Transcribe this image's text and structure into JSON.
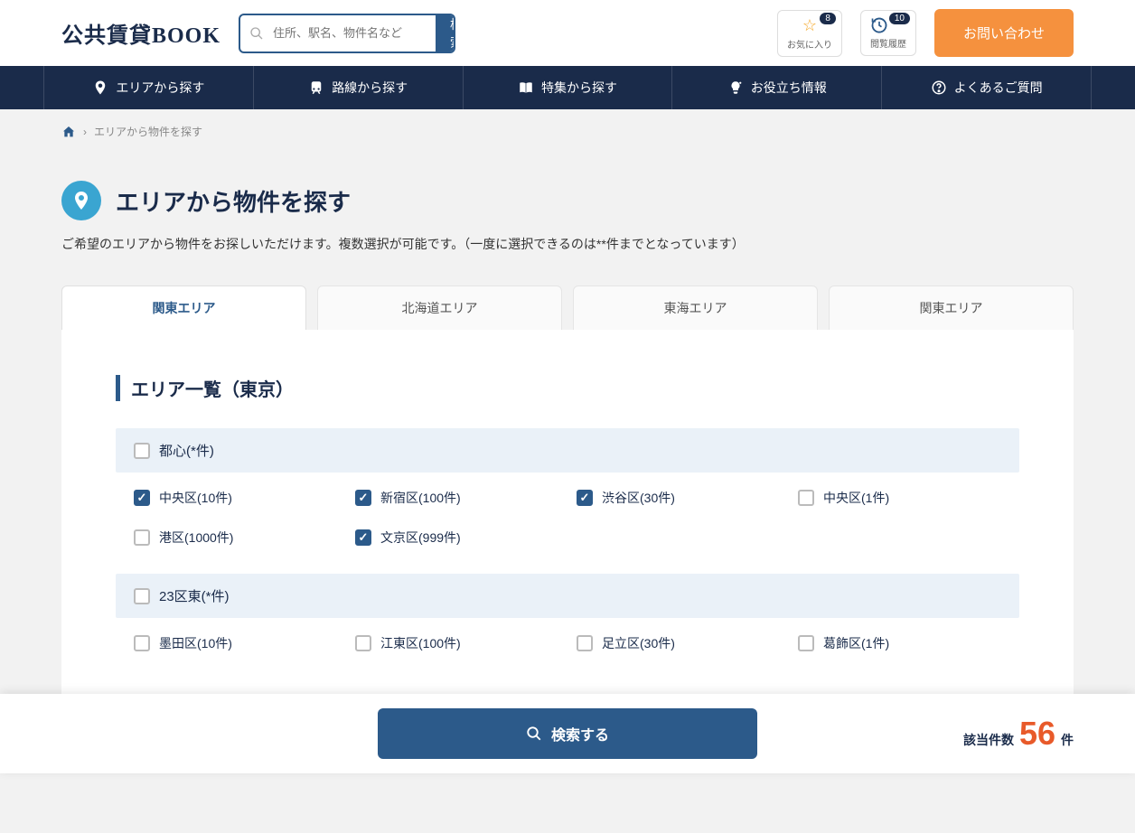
{
  "header": {
    "logo": "公共賃貸BOOK",
    "search_placeholder": "住所、駅名、物件名など",
    "search_button": "検索",
    "favorites_label": "お気に入り",
    "favorites_count": "8",
    "history_label": "閲覧履歴",
    "history_count": "10",
    "contact_label": "お問い合わせ"
  },
  "nav": {
    "area": "エリアから探す",
    "line": "路線から探す",
    "feature": "特集から探す",
    "info": "お役立ち情報",
    "faq": "よくあるご質問"
  },
  "breadcrumb": {
    "current": "エリアから物件を探す"
  },
  "page": {
    "title": "エリアから物件を探す",
    "desc": "ご希望のエリアから物件をお探しいただけます。複数選択が可能です。（一度に選択できるのは**件までとなっています）"
  },
  "tabs": [
    "関東エリア",
    "北海道エリア",
    "東海エリア",
    "関東エリア"
  ],
  "section_title": "エリア一覧（東京）",
  "groups": [
    {
      "header": "都心(*件)",
      "wards": [
        {
          "label": "中央区(10件)",
          "checked": true
        },
        {
          "label": "新宿区(100件)",
          "checked": true
        },
        {
          "label": "渋谷区(30件)",
          "checked": true
        },
        {
          "label": "中央区(1件)",
          "checked": false
        },
        {
          "label": "港区(1000件)",
          "checked": false
        },
        {
          "label": "文京区(999件)",
          "checked": true
        }
      ]
    },
    {
      "header": "23区東(*件)",
      "wards": [
        {
          "label": "墨田区(10件)",
          "checked": false
        },
        {
          "label": "江東区(100件)",
          "checked": false
        },
        {
          "label": "足立区(30件)",
          "checked": false
        },
        {
          "label": "葛飾区(1件)",
          "checked": false
        }
      ]
    }
  ],
  "footer": {
    "search_label": "検索する",
    "count_label": "該当件数",
    "count_value": "56",
    "count_unit": "件"
  }
}
